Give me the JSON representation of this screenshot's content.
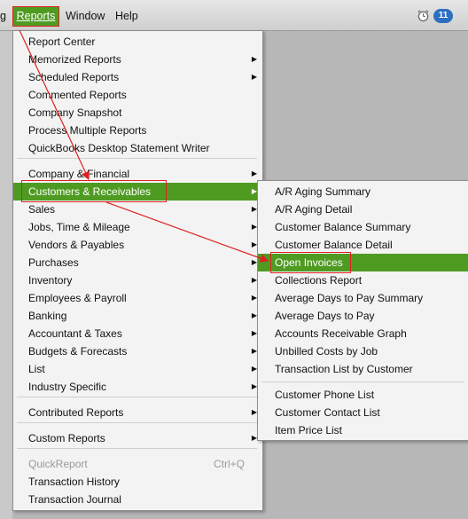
{
  "menubar": {
    "cut_item": "g",
    "reports": "Reports",
    "window": "Window",
    "help": "Help",
    "badge": "11"
  },
  "reports_menu": {
    "items": [
      {
        "label": "Report Center"
      },
      {
        "label": "Memorized Reports",
        "arrow": true
      },
      {
        "label": "Scheduled Reports",
        "arrow": true
      },
      {
        "label": "Commented Reports"
      },
      {
        "label": "Company Snapshot"
      },
      {
        "label": "Process Multiple Reports"
      },
      {
        "label": "QuickBooks Desktop Statement Writer"
      },
      {
        "label": "Company & Financial",
        "arrow": true
      },
      {
        "label": "Customers & Receivables",
        "arrow": true,
        "selected": true
      },
      {
        "label": "Sales",
        "arrow": true
      },
      {
        "label": "Jobs, Time & Mileage",
        "arrow": true
      },
      {
        "label": "Vendors & Payables",
        "arrow": true
      },
      {
        "label": "Purchases",
        "arrow": true
      },
      {
        "label": "Inventory",
        "arrow": true
      },
      {
        "label": "Employees & Payroll",
        "arrow": true
      },
      {
        "label": "Banking",
        "arrow": true
      },
      {
        "label": "Accountant & Taxes",
        "arrow": true
      },
      {
        "label": "Budgets & Forecasts",
        "arrow": true
      },
      {
        "label": "List",
        "arrow": true
      },
      {
        "label": "Industry Specific",
        "arrow": true
      },
      {
        "label": "Contributed Reports",
        "arrow": true
      },
      {
        "label": "Custom Reports",
        "arrow": true
      },
      {
        "label": "QuickReport",
        "shortcut": "Ctrl+Q",
        "disabled": true
      },
      {
        "label": "Transaction History"
      },
      {
        "label": "Transaction Journal"
      }
    ]
  },
  "sub_menu": {
    "items": [
      {
        "label": "A/R Aging Summary"
      },
      {
        "label": "A/R Aging Detail"
      },
      {
        "label": "Customer Balance Summary"
      },
      {
        "label": "Customer Balance Detail"
      },
      {
        "label": "Open Invoices",
        "selected": true
      },
      {
        "label": "Collections Report"
      },
      {
        "label": "Average Days to Pay Summary"
      },
      {
        "label": "Average Days to Pay"
      },
      {
        "label": "Accounts Receivable Graph"
      },
      {
        "label": "Unbilled Costs by Job"
      },
      {
        "label": "Transaction List by Customer"
      },
      {
        "label": "Customer Phone List"
      },
      {
        "label": "Customer Contact List"
      },
      {
        "label": "Item Price List"
      }
    ]
  },
  "colors": {
    "accent": "#4f9b22",
    "annotation": "#e02020"
  }
}
